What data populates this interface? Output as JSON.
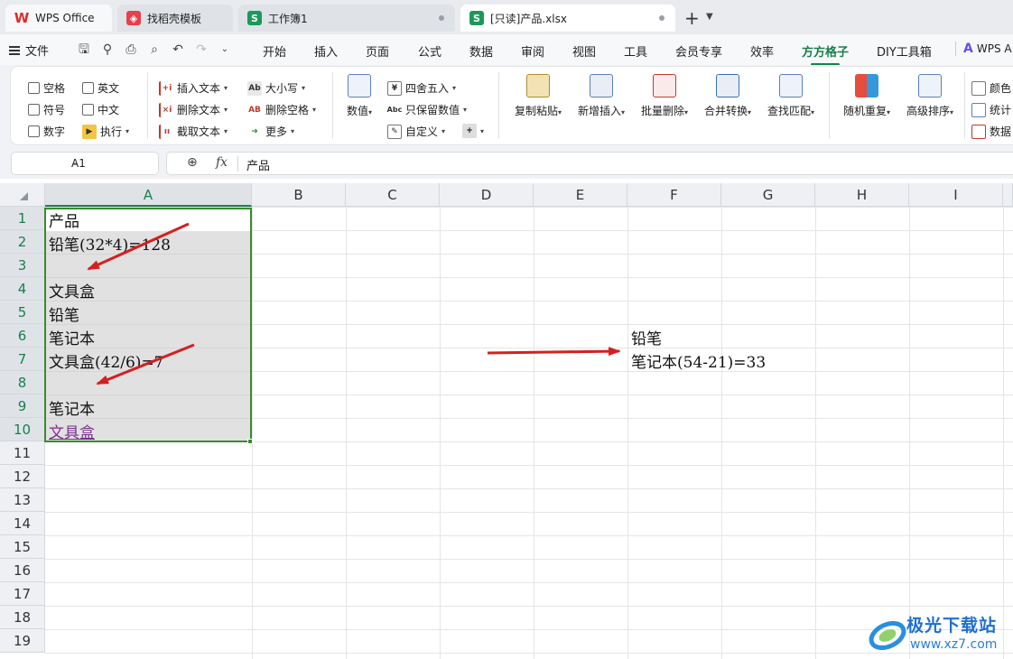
{
  "tabs": [
    {
      "label": "WPS Office",
      "icon": "wps-logo-icon"
    },
    {
      "label": "找稻壳模板",
      "icon": "template-icon"
    },
    {
      "label": "工作簿1",
      "icon": "spreadsheet-icon"
    },
    {
      "label": "[只读]产品.xlsx",
      "icon": "spreadsheet-icon"
    }
  ],
  "menu": {
    "file": "文件",
    "items": [
      "开始",
      "插入",
      "页面",
      "公式",
      "数据",
      "审阅",
      "视图",
      "工具",
      "会员专享",
      "效率",
      "方方格子",
      "DIY工具箱"
    ],
    "active": "方方格子",
    "ai": "WPS A"
  },
  "ribbon": {
    "checkboxes": [
      "空格",
      "英文",
      "符号",
      "中文",
      "数字"
    ],
    "execute": "执行",
    "text_tools": [
      "插入文本",
      "删除文本",
      "截取文本"
    ],
    "case_tools": [
      "大小写",
      "删除空格",
      "更多"
    ],
    "number": "数值",
    "number_tools": [
      "四舍五入",
      "只保留数值",
      "自定义"
    ],
    "big_buttons": [
      "复制粘贴",
      "新增插入",
      "批量删除",
      "合并转换",
      "查找匹配",
      "随机重复",
      "高级排序"
    ],
    "right_tools": [
      "颜色",
      "统计",
      "数据"
    ]
  },
  "formula_bar": {
    "name_box": "A1",
    "fx": "fx",
    "content": "产品"
  },
  "columns": [
    "A",
    "B",
    "C",
    "D",
    "E",
    "F",
    "G",
    "H",
    "I"
  ],
  "rows": [
    "1",
    "2",
    "3",
    "4",
    "5",
    "6",
    "7",
    "8",
    "9",
    "10",
    "11",
    "12",
    "13",
    "14",
    "15",
    "16",
    "17",
    "18",
    "19"
  ],
  "cells": {
    "A1": "产品",
    "A2": "铅笔(32*4)=128",
    "A3": "",
    "A4": "文具盒",
    "A5": "铅笔",
    "A6": "笔记本",
    "A7": "文具盒(42/6)=7",
    "A8": "",
    "A9": "笔记本",
    "A10": "文具盒",
    "F6": "铅笔",
    "F7": "笔记本(54-21)=33"
  },
  "colors": {
    "accent": "#1a7f4b",
    "selection_border": "#3b8a2e",
    "arrow": "#d42020",
    "link_text": "#7b2f8f"
  },
  "watermark": {
    "title": "极光下载站",
    "url": "www.xz7.com"
  }
}
